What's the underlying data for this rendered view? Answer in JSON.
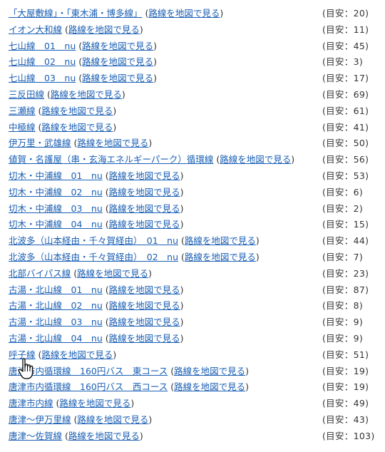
{
  "map_link_label": "路線を地図で見る",
  "routes": [
    {
      "name": "「大屋敷線」・「東木浦・博多線」",
      "count": "(目安：20)"
    },
    {
      "name": "イオン大和線",
      "count": "(目安：11)"
    },
    {
      "name": "七山線　01　nu",
      "count": "(目安：45)"
    },
    {
      "name": "七山線　02　nu",
      "count": "(目安：3)"
    },
    {
      "name": "七山線　03　nu",
      "count": "(目安：17)"
    },
    {
      "name": "三反田線",
      "count": "(目安：69)"
    },
    {
      "name": "三瀬線",
      "count": "(目安：61)"
    },
    {
      "name": "中極線",
      "count": "(目安：41)"
    },
    {
      "name": "伊万里・武雄線",
      "count": "(目安：50)"
    },
    {
      "name": "値賀・名護屋（串・玄海エネルギーパーク）循環線",
      "count": "(目安：56)"
    },
    {
      "name": "切木・中浦線　01　nu",
      "count": "(目安：53)"
    },
    {
      "name": "切木・中浦線　02　nu",
      "count": "(目安：6)"
    },
    {
      "name": "切木・中浦線　03　nu",
      "count": "(目安：2)"
    },
    {
      "name": "切木・中浦線　04　nu",
      "count": "(目安：15)"
    },
    {
      "name": "北波多（山本経由・千々賀経由）　01　nu",
      "count": "(目安：44)"
    },
    {
      "name": "北波多（山本経由・千々賀経由）　02　nu",
      "count": "(目安：7)"
    },
    {
      "name": "北部バイパス線",
      "count": "(目安：23)"
    },
    {
      "name": "古湯・北山線　01　nu",
      "count": "(目安：87)"
    },
    {
      "name": "古湯・北山線　02　nu",
      "count": "(目安：8)"
    },
    {
      "name": "古湯・北山線　03　nu",
      "count": "(目安：9)"
    },
    {
      "name": "古湯・北山線　04　nu",
      "count": "(目安：9)"
    },
    {
      "name": "呼子線",
      "count": "(目安：51)"
    },
    {
      "name": "唐津市内循環線　160円バス　東コース",
      "count": "(目安：19)"
    },
    {
      "name": "唐津市内循環線　160円バス　西コース",
      "count": "(目安：19)"
    },
    {
      "name": "唐津市内線",
      "count": "(目安：49)"
    },
    {
      "name": "唐津～伊万里線",
      "count": "(目安：43)"
    },
    {
      "name": "唐津～佐賀線",
      "count": "(目安：103)"
    }
  ],
  "cursor": {
    "icon": "hand-pointer-icon"
  }
}
